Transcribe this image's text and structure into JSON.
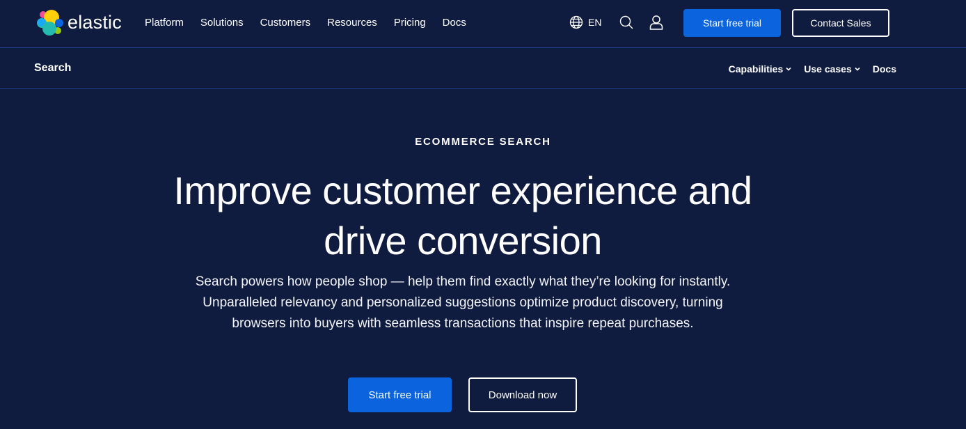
{
  "brand": {
    "name": "elastic",
    "logo_icon": "elastic-logo-icon"
  },
  "nav": {
    "items": [
      "Platform",
      "Solutions",
      "Customers",
      "Resources",
      "Pricing",
      "Docs"
    ],
    "language": "EN",
    "icons": {
      "globe": "globe-icon",
      "search": "search-icon",
      "user": "user-icon"
    },
    "trial_button": "Start free trial",
    "contact_button": "Contact Sales"
  },
  "subnav": {
    "title": "Search",
    "links": [
      {
        "label": "Capabilities",
        "has_dropdown": true
      },
      {
        "label": "Use cases",
        "has_dropdown": true
      },
      {
        "label": "Docs",
        "has_dropdown": false
      }
    ]
  },
  "hero": {
    "eyebrow": "ECOMMERCE SEARCH",
    "headline_line1": "Improve customer experience and",
    "headline_line2": "drive conversion",
    "description": "Search powers how people shop — help them find exactly what they’re looking for instantly. Unparalleled relevancy and personalized suggestions optimize product discovery, turning browsers into buyers with seamless transactions that inspire repeat purchases.",
    "primary_button": "Start free trial",
    "secondary_button": "Download now"
  },
  "colors": {
    "background": "#101c3f",
    "primary": "#0b64dd",
    "divider": "#1f3f8f",
    "text": "#ffffff"
  }
}
